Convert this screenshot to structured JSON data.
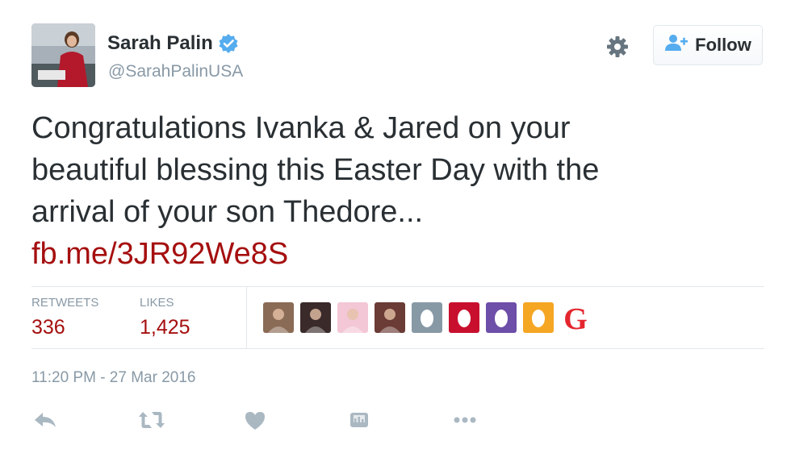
{
  "user": {
    "name": "Sarah Palin",
    "handle": "@SarahPalinUSA",
    "verified": true
  },
  "header": {
    "follow_label": "Follow",
    "settings_icon": "gear-icon",
    "follow_icon": "person-add-icon"
  },
  "tweet": {
    "text_lines": [
      "Congratulations Ivanka & Jared on your",
      "beautiful blessing this Easter Day with the",
      "arrival of your son Thedore..."
    ],
    "link": "fb.me/3JR92We8S"
  },
  "stats": {
    "retweets_label": "RETWEETS",
    "retweets_value": "336",
    "likes_label": "LIKES",
    "likes_value": "1,425"
  },
  "likers": [
    {
      "name": "liker-avatar-1",
      "color": "#8a6b55"
    },
    {
      "name": "liker-avatar-2",
      "color": "#3a2a2a"
    },
    {
      "name": "liker-avatar-3",
      "color": "#f3c7d6"
    },
    {
      "name": "liker-avatar-4",
      "color": "#6b3b35"
    },
    {
      "name": "liker-avatar-5",
      "color": "#8899a6"
    },
    {
      "name": "liker-avatar-6",
      "color": "#c8102e"
    },
    {
      "name": "liker-avatar-7",
      "color": "#6d4ea8"
    },
    {
      "name": "liker-avatar-8",
      "color": "#f5a623"
    },
    {
      "name": "liker-avatar-9",
      "letter": "G",
      "color": "#e3262e"
    }
  ],
  "timestamp": "11:20 PM - 27 Mar 2016",
  "actions": [
    "reply-icon",
    "retweet-icon",
    "like-icon",
    "analytics-icon",
    "more-icon"
  ],
  "colors": {
    "link": "#a50f0f",
    "muted": "#8899a6",
    "verified": "#55acee",
    "text": "#292f33"
  }
}
